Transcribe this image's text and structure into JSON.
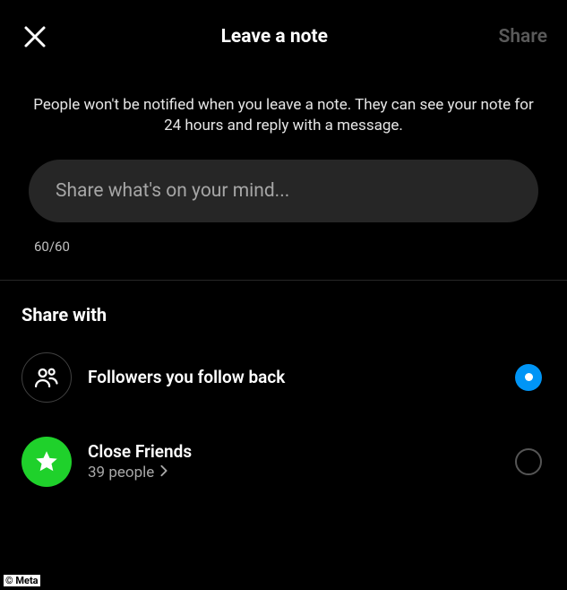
{
  "header": {
    "title": "Leave a note",
    "share_label": "Share"
  },
  "description": "People won't be notified when you leave a note. They can see your note for 24 hours and reply with a message.",
  "compose": {
    "placeholder": "Share what's on your mind...",
    "counter": "60/60"
  },
  "shareWith": {
    "heading": "Share with",
    "options": [
      {
        "label": "Followers you follow back",
        "subtitle": "",
        "selected": true
      },
      {
        "label": "Close Friends",
        "subtitle": "39 people",
        "selected": false
      }
    ]
  },
  "credit": "© Meta"
}
